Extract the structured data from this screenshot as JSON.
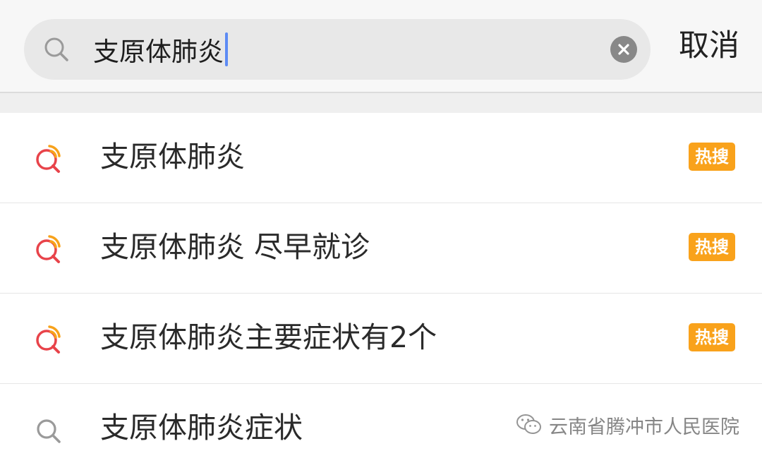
{
  "search": {
    "query": "支原体肺炎",
    "cancel_label": "取消"
  },
  "icons": {
    "search": "search-icon",
    "clear": "clear-icon",
    "hot_search": "hot-search-icon"
  },
  "suggestions": [
    {
      "text": "支原体肺炎",
      "badge": "热搜",
      "icon": "hot-search-icon"
    },
    {
      "text": "支原体肺炎 尽早就诊",
      "badge": "热搜",
      "icon": "hot-search-icon"
    },
    {
      "text": "支原体肺炎主要症状有2个",
      "badge": "热搜",
      "icon": "hot-search-icon"
    },
    {
      "text": "支原体肺炎症状",
      "badge": "",
      "icon": "search-icon"
    }
  ],
  "watermark": {
    "text": "云南省腾冲市人民医院"
  },
  "colors": {
    "caret": "#5d8bf4",
    "hot_badge": "#f9a21b",
    "hot_icon_red": "#e8434a",
    "hot_icon_orange": "#f7a21b",
    "search_box_bg": "#e8e8e8"
  }
}
